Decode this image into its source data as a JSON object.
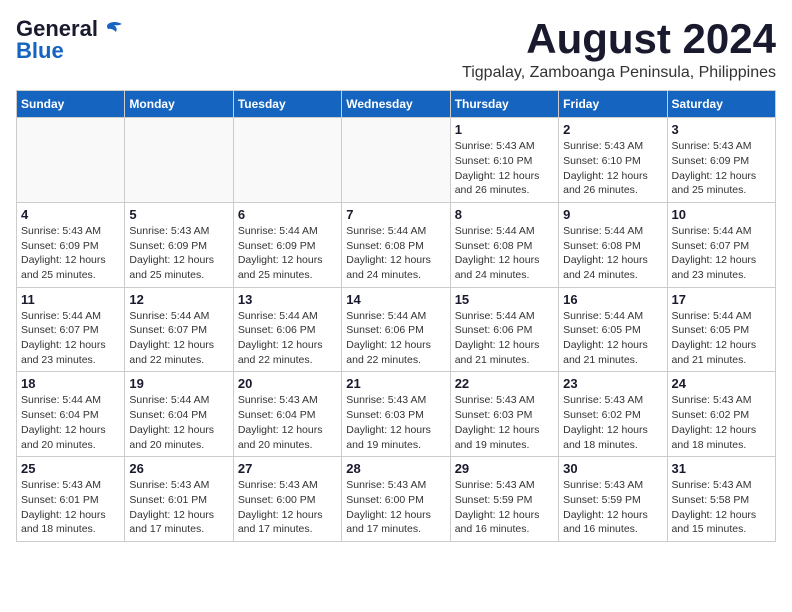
{
  "logo": {
    "line1": "General",
    "line2": "Blue"
  },
  "header": {
    "month_year": "August 2024",
    "location": "Tigpalay, Zamboanga Peninsula, Philippines"
  },
  "weekdays": [
    "Sunday",
    "Monday",
    "Tuesday",
    "Wednesday",
    "Thursday",
    "Friday",
    "Saturday"
  ],
  "weeks": [
    [
      {
        "day": "",
        "info": ""
      },
      {
        "day": "",
        "info": ""
      },
      {
        "day": "",
        "info": ""
      },
      {
        "day": "",
        "info": ""
      },
      {
        "day": "1",
        "info": "Sunrise: 5:43 AM\nSunset: 6:10 PM\nDaylight: 12 hours\nand 26 minutes."
      },
      {
        "day": "2",
        "info": "Sunrise: 5:43 AM\nSunset: 6:10 PM\nDaylight: 12 hours\nand 26 minutes."
      },
      {
        "day": "3",
        "info": "Sunrise: 5:43 AM\nSunset: 6:09 PM\nDaylight: 12 hours\nand 25 minutes."
      }
    ],
    [
      {
        "day": "4",
        "info": "Sunrise: 5:43 AM\nSunset: 6:09 PM\nDaylight: 12 hours\nand 25 minutes."
      },
      {
        "day": "5",
        "info": "Sunrise: 5:43 AM\nSunset: 6:09 PM\nDaylight: 12 hours\nand 25 minutes."
      },
      {
        "day": "6",
        "info": "Sunrise: 5:44 AM\nSunset: 6:09 PM\nDaylight: 12 hours\nand 25 minutes."
      },
      {
        "day": "7",
        "info": "Sunrise: 5:44 AM\nSunset: 6:08 PM\nDaylight: 12 hours\nand 24 minutes."
      },
      {
        "day": "8",
        "info": "Sunrise: 5:44 AM\nSunset: 6:08 PM\nDaylight: 12 hours\nand 24 minutes."
      },
      {
        "day": "9",
        "info": "Sunrise: 5:44 AM\nSunset: 6:08 PM\nDaylight: 12 hours\nand 24 minutes."
      },
      {
        "day": "10",
        "info": "Sunrise: 5:44 AM\nSunset: 6:07 PM\nDaylight: 12 hours\nand 23 minutes."
      }
    ],
    [
      {
        "day": "11",
        "info": "Sunrise: 5:44 AM\nSunset: 6:07 PM\nDaylight: 12 hours\nand 23 minutes."
      },
      {
        "day": "12",
        "info": "Sunrise: 5:44 AM\nSunset: 6:07 PM\nDaylight: 12 hours\nand 22 minutes."
      },
      {
        "day": "13",
        "info": "Sunrise: 5:44 AM\nSunset: 6:06 PM\nDaylight: 12 hours\nand 22 minutes."
      },
      {
        "day": "14",
        "info": "Sunrise: 5:44 AM\nSunset: 6:06 PM\nDaylight: 12 hours\nand 22 minutes."
      },
      {
        "day": "15",
        "info": "Sunrise: 5:44 AM\nSunset: 6:06 PM\nDaylight: 12 hours\nand 21 minutes."
      },
      {
        "day": "16",
        "info": "Sunrise: 5:44 AM\nSunset: 6:05 PM\nDaylight: 12 hours\nand 21 minutes."
      },
      {
        "day": "17",
        "info": "Sunrise: 5:44 AM\nSunset: 6:05 PM\nDaylight: 12 hours\nand 21 minutes."
      }
    ],
    [
      {
        "day": "18",
        "info": "Sunrise: 5:44 AM\nSunset: 6:04 PM\nDaylight: 12 hours\nand 20 minutes."
      },
      {
        "day": "19",
        "info": "Sunrise: 5:44 AM\nSunset: 6:04 PM\nDaylight: 12 hours\nand 20 minutes."
      },
      {
        "day": "20",
        "info": "Sunrise: 5:43 AM\nSunset: 6:04 PM\nDaylight: 12 hours\nand 20 minutes."
      },
      {
        "day": "21",
        "info": "Sunrise: 5:43 AM\nSunset: 6:03 PM\nDaylight: 12 hours\nand 19 minutes."
      },
      {
        "day": "22",
        "info": "Sunrise: 5:43 AM\nSunset: 6:03 PM\nDaylight: 12 hours\nand 19 minutes."
      },
      {
        "day": "23",
        "info": "Sunrise: 5:43 AM\nSunset: 6:02 PM\nDaylight: 12 hours\nand 18 minutes."
      },
      {
        "day": "24",
        "info": "Sunrise: 5:43 AM\nSunset: 6:02 PM\nDaylight: 12 hours\nand 18 minutes."
      }
    ],
    [
      {
        "day": "25",
        "info": "Sunrise: 5:43 AM\nSunset: 6:01 PM\nDaylight: 12 hours\nand 18 minutes."
      },
      {
        "day": "26",
        "info": "Sunrise: 5:43 AM\nSunset: 6:01 PM\nDaylight: 12 hours\nand 17 minutes."
      },
      {
        "day": "27",
        "info": "Sunrise: 5:43 AM\nSunset: 6:00 PM\nDaylight: 12 hours\nand 17 minutes."
      },
      {
        "day": "28",
        "info": "Sunrise: 5:43 AM\nSunset: 6:00 PM\nDaylight: 12 hours\nand 17 minutes."
      },
      {
        "day": "29",
        "info": "Sunrise: 5:43 AM\nSunset: 5:59 PM\nDaylight: 12 hours\nand 16 minutes."
      },
      {
        "day": "30",
        "info": "Sunrise: 5:43 AM\nSunset: 5:59 PM\nDaylight: 12 hours\nand 16 minutes."
      },
      {
        "day": "31",
        "info": "Sunrise: 5:43 AM\nSunset: 5:58 PM\nDaylight: 12 hours\nand 15 minutes."
      }
    ]
  ]
}
